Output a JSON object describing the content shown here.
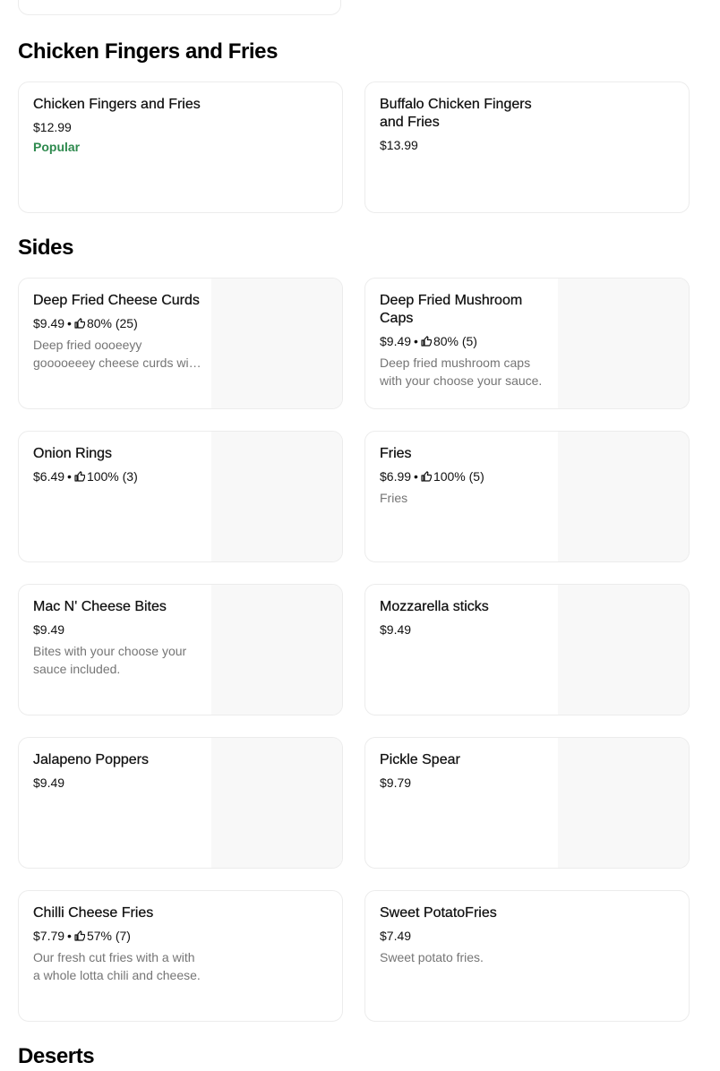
{
  "sections": [
    {
      "title": "Chicken Fingers and Fries",
      "items": [
        {
          "name": "Chicken Fingers and Fries",
          "price": "$12.99",
          "badge": "Popular"
        },
        {
          "name": "Buffalo Chicken Fingers and Fries",
          "price": "$13.99"
        }
      ]
    },
    {
      "title": "Sides",
      "items": [
        {
          "name": "Deep Fried Cheese Curds",
          "price": "$9.49",
          "rating": "80% (25)",
          "description": "Deep fried oooeeyy gooooeeey cheese curds with your choose your sauce.",
          "has_image": true
        },
        {
          "name": "Deep Fried Mushroom Caps",
          "price": "$9.49",
          "rating": "80% (5)",
          "description": "Deep fried mushroom caps with your choose your sauce.",
          "has_image": true
        },
        {
          "name": "Onion Rings",
          "price": "$6.49",
          "rating": "100% (3)",
          "has_image": true
        },
        {
          "name": "Fries",
          "price": "$6.99",
          "rating": "100% (5)",
          "description": "Fries",
          "has_image": true
        },
        {
          "name": "Mac N' Cheese Bites",
          "price": "$9.49",
          "description": "Bites with your choose your sauce included.",
          "has_image": true
        },
        {
          "name": "Mozzarella sticks",
          "price": "$9.49",
          "has_image": true
        },
        {
          "name": "Jalapeno Poppers",
          "price": "$9.49",
          "has_image": true
        },
        {
          "name": "Pickle Spear",
          "price": "$9.79",
          "has_image": true
        },
        {
          "name": "Chilli Cheese Fries",
          "price": "$7.79",
          "rating": "57% (7)",
          "description": "Our fresh cut fries with a with a whole lotta chili and cheese."
        },
        {
          "name": "Sweet PotatoFries",
          "price": "$7.49",
          "description": "Sweet potato fries."
        }
      ]
    },
    {
      "title": "Deserts",
      "items": []
    }
  ],
  "colors": {
    "popular_badge": "#2e8a4e",
    "description_text": "#757575",
    "card_border": "#ececec",
    "image_placeholder": "#f8f8f8"
  },
  "icons": {
    "rating": "thumbs-up-icon"
  }
}
